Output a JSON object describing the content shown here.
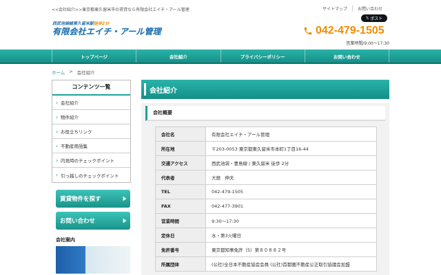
{
  "header": {
    "topline": "<<会社紹介>>東京都東久留米市の賃貸なら有限会社エイチ・アール管理",
    "links": [
      "サイトマップ",
      "お問い合わせ"
    ],
    "post_button": "ポスト",
    "logo_sub_1": "西武池袋線",
    "logo_sub_2": "東久留米駅",
    "logo_sub_3": "徒歩2分",
    "logo_main": "有限会社エイチ・アール管理",
    "phone": "042-479-1505",
    "hours": "営業時間/9:00〜17:30"
  },
  "nav": {
    "items": [
      "トップページ",
      "会社紹介",
      "プライバシーポリシー",
      "お問い合わせ"
    ]
  },
  "breadcrumb": {
    "home": "ホーム",
    "separator": ">",
    "current": "会社紹介"
  },
  "sidebar": {
    "title": "コンテンツ一覧",
    "items": [
      "会社紹介",
      "物件紹介",
      "お役立ちリンク",
      "不動産用語集",
      "内見時のチェックポイント",
      "引っ越しのチェックポイント"
    ],
    "banner_1": "賃貸物件を探す",
    "banner_2": "お問い合わせ",
    "company_guide": "会社案内"
  },
  "main": {
    "heading": "会社紹介",
    "subheading": "会社概要",
    "rows": [
      {
        "label": "会社名",
        "value": "有限会社エイチ・アール管理"
      },
      {
        "label": "所在地",
        "value": "〒203-0053 東京都東久留米市本町1丁目16-44"
      },
      {
        "label": "交通アクセス",
        "value": "西武池袋・豊島線 / 東久留米 徒歩 2分"
      },
      {
        "label": "代表者",
        "value": "大舘　伸夫"
      },
      {
        "label": "TEL",
        "value": "042-479-1505"
      },
      {
        "label": "FAX",
        "value": "042-477-3901"
      },
      {
        "label": "営業時間",
        "value": "9:30〜17:30"
      },
      {
        "label": "定休日",
        "value": "水・第3火曜日"
      },
      {
        "label": "免許番号",
        "value": "東京都知事免許（5）第８０８８２号"
      },
      {
        "label": "所属団体",
        "value": "(公社)全日本不動産協会会員 (公社)首都圏不動産公正取引協議会加盟"
      }
    ]
  },
  "colors": {
    "accent": "#1aa19a",
    "brand_blue": "#1c6fb0",
    "phone_orange": "#f08c00"
  }
}
